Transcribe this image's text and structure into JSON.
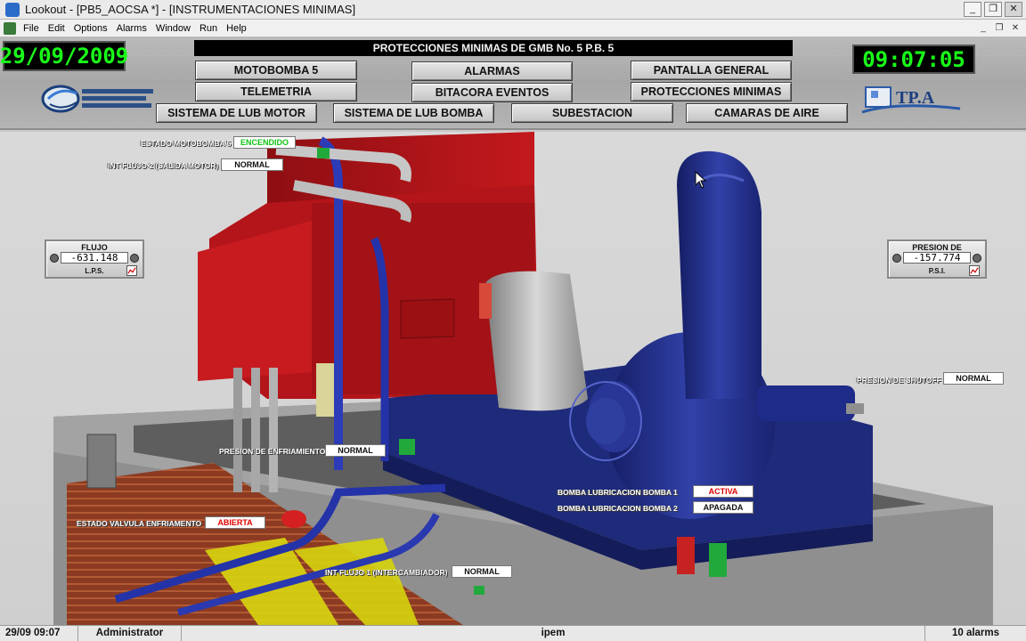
{
  "window": {
    "title": "Lookout - [PB5_AOCSA *] - [INSTRUMENTACIONES MINIMAS]",
    "minimize": "_",
    "restore": "❐",
    "close": "✕"
  },
  "menu": {
    "items": [
      "File",
      "Edit",
      "Options",
      "Alarms",
      "Window",
      "Run",
      "Help"
    ],
    "mdi_minimize": "_",
    "mdi_restore": "❐",
    "mdi_close": "✕"
  },
  "header": {
    "date": "29/09/2009",
    "time": "09:07:05",
    "banner": "PROTECCIONES MINIMAS DE GMB No. 5 P.B. 5",
    "logo_right_text": "TP.A",
    "nav": {
      "motobomba": "MOTOBOMBA 5",
      "telemetria": "TELEMETRIA",
      "alarmas": "ALARMAS",
      "bitacora": "BITACORA EVENTOS",
      "pantalla_general": "PANTALLA GENERAL",
      "protecciones": "PROTECCIONES MINIMAS",
      "lub_motor": "SISTEMA DE LUB MOTOR",
      "lub_bomba": "SISTEMA DE LUB BOMBA",
      "subestacion": "SUBESTACION",
      "camaras": "CAMARAS DE AIRE"
    }
  },
  "status": {
    "estado_motobomba": {
      "label": "ESTADO MOTOBOMBA 5",
      "value": "ENCENDIDO"
    },
    "int_flujo_2": {
      "label": "INT FLUJO 2 (SALIDA MOTOR)",
      "value": "NORMAL"
    },
    "presion_enfriamiento": {
      "label": "PRESION DE ENFRIAMIENTO",
      "value": "NORMAL"
    },
    "estado_valvula": {
      "label": "ESTADO VALVULA ENFRIAMENTO",
      "value": "ABIERTA"
    },
    "int_flujo_1": {
      "label": "INT FLUJO 1 (INTERCAMBIADOR)",
      "value": "NORMAL"
    },
    "bomba_lub_1": {
      "label": "BOMBA LUBRICACION BOMBA 1",
      "value": "ACTIVA"
    },
    "bomba_lub_2": {
      "label": "BOMBA LUBRICACION BOMBA 2",
      "value": "APAGADA"
    },
    "presion_shutoff": {
      "label": "PRESION DE SHUTOFF",
      "value": "NORMAL"
    }
  },
  "gauges": {
    "flujo": {
      "title": "FLUJO",
      "value": "-631.148",
      "unit": "L.P.S."
    },
    "descarga": {
      "title": "PRESION DE DESCARGA",
      "value": "-157.774",
      "unit": "P.S.I."
    }
  },
  "statusbar": {
    "datetime": "29/09 09:07",
    "user": "Administrator",
    "host": "ipem",
    "alarms": "10 alarms"
  },
  "colors": {
    "lcd_green": "#19ff19",
    "motor_red": "#b5161a",
    "pump_blue": "#1e2a8a",
    "active_red": "#e10000",
    "on_green": "#11c211"
  }
}
